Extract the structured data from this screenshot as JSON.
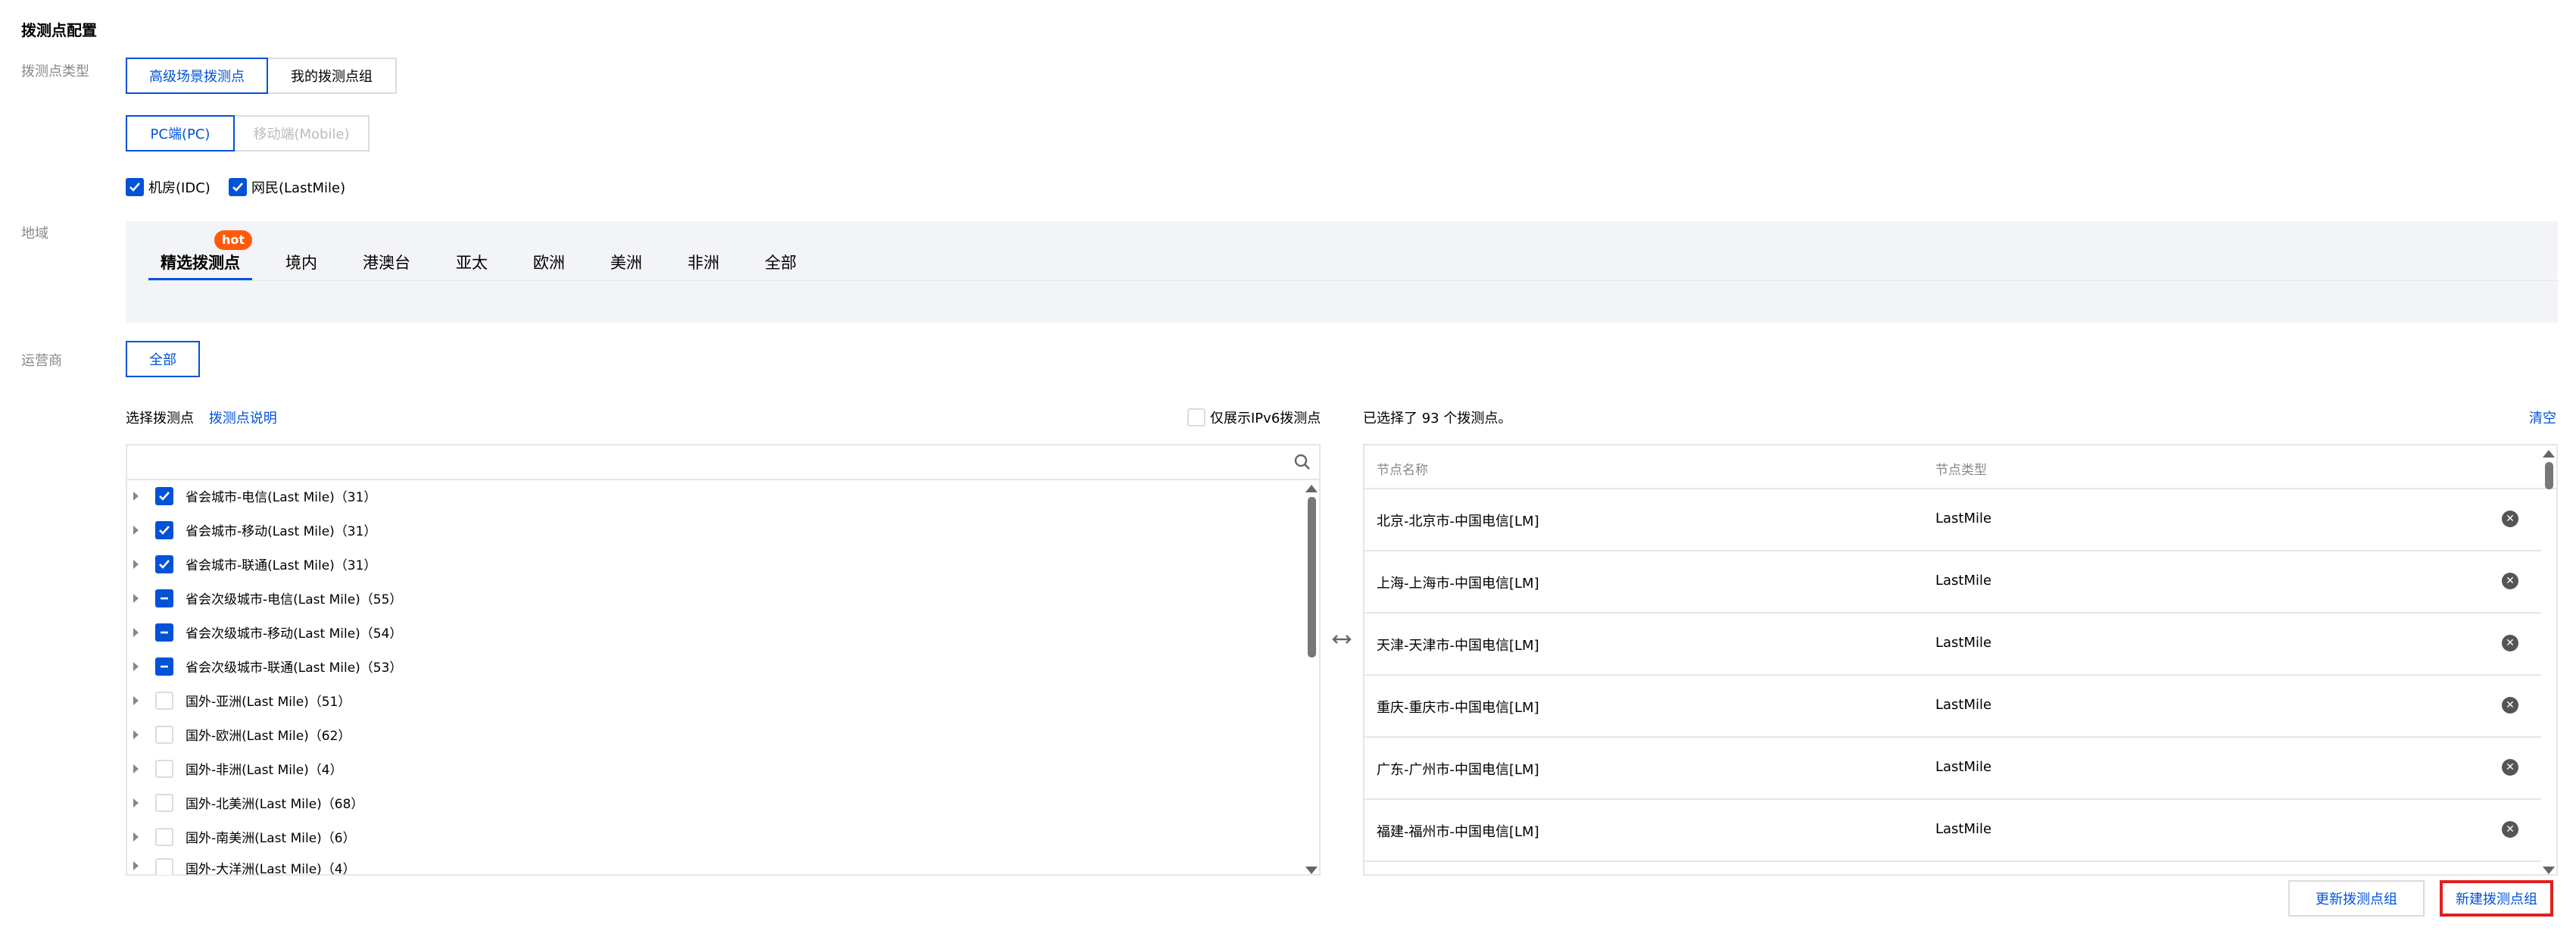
{
  "page": {
    "title": "拨测点配置"
  },
  "probe_type": {
    "label": "拨测点类型",
    "options": [
      "高级场景拨测点",
      "我的拨测点组"
    ],
    "selected": "高级场景拨测点"
  },
  "terminal": {
    "options": [
      "PC端(PC)",
      "移动端(Mobile)"
    ],
    "selected": "PC端(PC)"
  },
  "node_kinds": [
    {
      "label": "机房(IDC)",
      "checked": true
    },
    {
      "label": "网民(LastMile)",
      "checked": true
    }
  ],
  "region": {
    "label": "地域",
    "tabs": [
      "精选拨测点",
      "境内",
      "港澳台",
      "亚太",
      "欧洲",
      "美洲",
      "非洲",
      "全部"
    ],
    "active_tab": "精选拨测点",
    "badge": "hot"
  },
  "operator": {
    "label": "运营商",
    "options": [
      "全部"
    ],
    "selected": "全部"
  },
  "picker": {
    "title": "选择拨测点",
    "help_link": "拨测点说明",
    "ipv6_only_label": "仅展示IPv6拨测点",
    "ipv6_only_checked": false,
    "search": {
      "value": "",
      "placeholder": ""
    },
    "tree": [
      {
        "label": "省会城市-电信(Last Mile)（31）",
        "state": "checked"
      },
      {
        "label": "省会城市-移动(Last Mile)（31）",
        "state": "checked"
      },
      {
        "label": "省会城市-联通(Last Mile)（31）",
        "state": "checked"
      },
      {
        "label": "省会次级城市-电信(Last Mile)（55）",
        "state": "indeterminate"
      },
      {
        "label": "省会次级城市-移动(Last Mile)（54）",
        "state": "indeterminate"
      },
      {
        "label": "省会次级城市-联通(Last Mile)（53）",
        "state": "indeterminate"
      },
      {
        "label": "国外-亚洲(Last Mile)（51）",
        "state": "unchecked"
      },
      {
        "label": "国外-欧洲(Last Mile)（62）",
        "state": "unchecked"
      },
      {
        "label": "国外-非洲(Last Mile)（4）",
        "state": "unchecked"
      },
      {
        "label": "国外-北美洲(Last Mile)（68）",
        "state": "unchecked"
      },
      {
        "label": "国外-南美洲(Last Mile)（6）",
        "state": "unchecked"
      },
      {
        "label": "国外-大洋洲(Last Mile)（4）",
        "state": "unchecked"
      }
    ]
  },
  "selected": {
    "summary": "已选择了 93 个拨测点。",
    "clear_label": "清空",
    "columns": [
      "节点名称",
      "节点类型"
    ],
    "rows": [
      {
        "name": "北京-北京市-中国电信[LM]",
        "type": "LastMile"
      },
      {
        "name": "上海-上海市-中国电信[LM]",
        "type": "LastMile"
      },
      {
        "name": "天津-天津市-中国电信[LM]",
        "type": "LastMile"
      },
      {
        "name": "重庆-重庆市-中国电信[LM]",
        "type": "LastMile"
      },
      {
        "name": "广东-广州市-中国电信[LM]",
        "type": "LastMile"
      },
      {
        "name": "福建-福州市-中国电信[LM]",
        "type": "LastMile"
      }
    ]
  },
  "actions": {
    "update_group_label": "更新拨测点组",
    "create_group_label": "新建拨测点组"
  },
  "colors": {
    "primary": "#0052d9",
    "hot_badge": "#ff5b0a",
    "highlight_box": "#e02020",
    "panel_bg": "#f3f4f7"
  },
  "icons": {
    "search": "search-icon",
    "transfer": "transfer-arrows-icon",
    "remove": "remove-circle-icon",
    "tree_expand": "caret-right-icon",
    "checkbox_checked": "checkmark-icon",
    "checkbox_indeterminate": "minus-icon"
  }
}
